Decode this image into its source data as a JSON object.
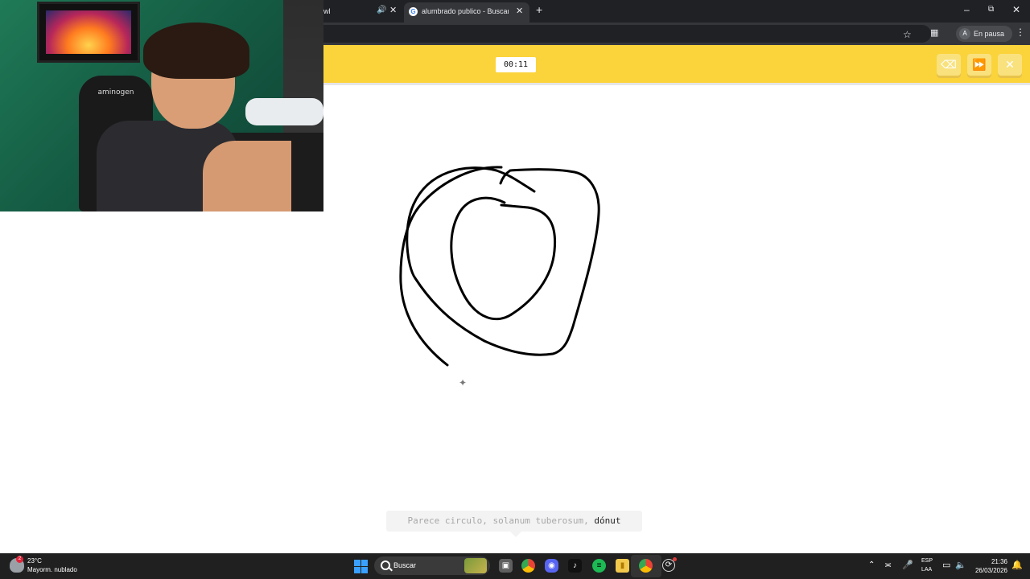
{
  "browser": {
    "prev_tab_label": "wl",
    "active_tab_title": "alumbrado publico - Buscar con",
    "profile_initial": "A",
    "profile_status": "En pausa",
    "icons": {
      "speaker": "speaker-icon",
      "close": "close-icon",
      "new_tab": "plus-icon",
      "star": "star-icon",
      "extensions": "puzzle-icon",
      "menu": "kebab-menu-icon"
    }
  },
  "webcam": {
    "chair_logo": "aminogen"
  },
  "game": {
    "timer": "00:11",
    "accent_color": "#fbd33b",
    "buttons": [
      "eraser-icon",
      "fast-forward-icon",
      "close-icon"
    ]
  },
  "guess": {
    "prefix": "Parece circulo, solanum tuberosum,",
    "highlight": "dónut"
  },
  "taskbar": {
    "weather_badge": "2",
    "weather_temp": "23°C",
    "weather_desc": "Mayorm. nublado",
    "search_label": "Buscar",
    "lang_line1": "ESP",
    "lang_line2": "LAA",
    "time": "21:36",
    "date": "26/03/2026",
    "apps": [
      "task-view-icon",
      "chrome-icon",
      "discord-icon",
      "tiktok-icon",
      "spotify-icon",
      "file-explorer-icon",
      "chrome-icon",
      "app-icon"
    ]
  }
}
